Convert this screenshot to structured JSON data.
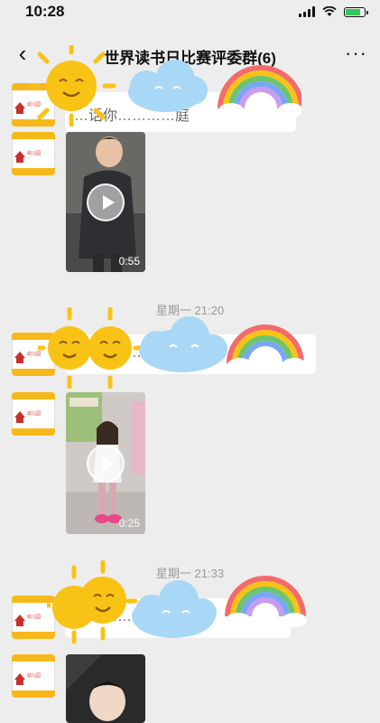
{
  "status": {
    "time": "10:28"
  },
  "header": {
    "back": "‹",
    "title": "世界读书日比赛评委群(6)",
    "more": "···"
  },
  "avatar_text": "幼儿园",
  "messages": [
    {
      "text": "…话你…………庭"
    },
    {
      "duration": "0:55"
    },
    {
      "timestamp": "星期一 21:20"
    },
    {
      "text": "…………… … …"
    },
    {
      "duration": "0:25"
    },
    {
      "timestamp": "星期一 21:33"
    },
    {
      "text": "…………… …"
    }
  ],
  "colors": {
    "background": "#ededed",
    "avatar_band": "#f7b81b",
    "sun": "#f9c316",
    "cloud": "#a8d8f5"
  }
}
